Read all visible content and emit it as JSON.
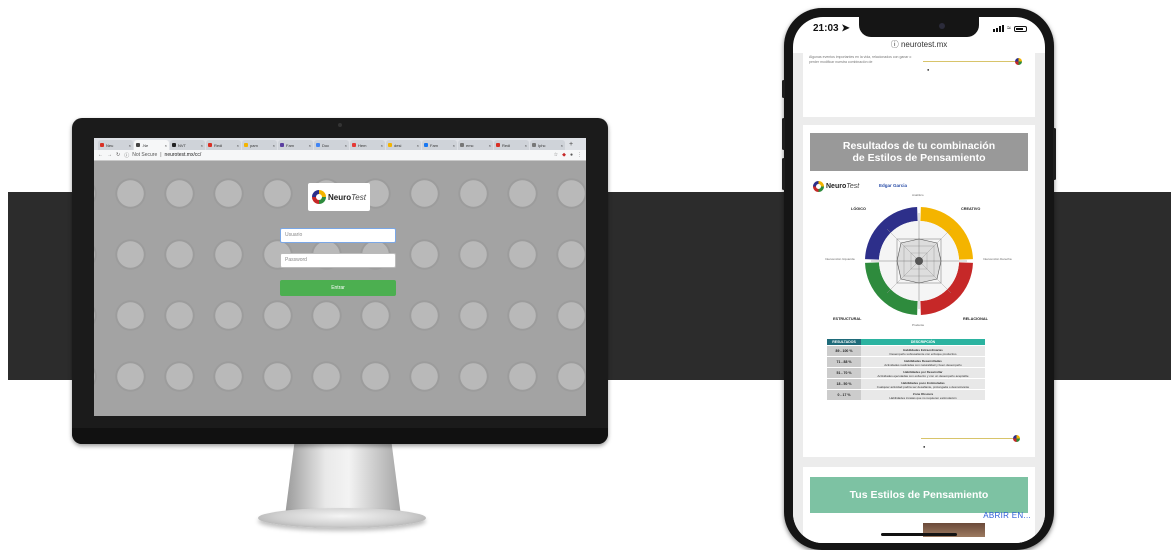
{
  "desktop": {
    "tabs": [
      {
        "label": "Neu",
        "color": "#d93025"
      },
      {
        "label": ".Ne",
        "color": "#444444",
        "active": true
      },
      {
        "label": "NVT",
        "color": "#222222"
      },
      {
        "label": "Redi",
        "color": "#d93025"
      },
      {
        "label": "pam",
        "color": "#f4b400"
      },
      {
        "label": "Fam",
        "color": "#5b3fa0"
      },
      {
        "label": "Doc",
        "color": "#4285f4"
      },
      {
        "label": "Hem",
        "color": "#e53935"
      },
      {
        "label": "desi",
        "color": "#f4b400"
      },
      {
        "label": "Fam",
        "color": "#1877f2"
      },
      {
        "label": "emc",
        "color": "#777777"
      },
      {
        "label": "Redi",
        "color": "#d93025"
      },
      {
        "label": "Iphc",
        "color": "#777777"
      }
    ],
    "new_tab": "+",
    "address": {
      "security": "Not Secure",
      "separator": "|",
      "url": "neurotest.mx/cc/"
    },
    "logo": {
      "brand": "Neuro",
      "brand_suffix": "Test"
    },
    "username_placeholder": "Usuario",
    "password_placeholder": "Password",
    "submit_label": "Entrar"
  },
  "phone": {
    "time": "21:03",
    "url": "neurotest.mx",
    "card1_text": "Algunas eventos importantes en la vida, relacionados con ganar o perder modificar nuestra combinación de",
    "results_title_line1": "Resultados de tu combinación",
    "results_title_line2": "de Estilos de Pensamiento",
    "logo": {
      "brand": "Neuro",
      "brand_suffix": "Test"
    },
    "user_name": "Edgar Garcia",
    "quadrants": {
      "top_left": "LÓGICO",
      "top_right": "CREATIVO",
      "bottom_left": "ESTRUCTURAL",
      "bottom_right": "RELACIONAL"
    },
    "sides": {
      "top": "Analítico",
      "left": "Intervención Izquierda",
      "right": "Intervención Derecha",
      "bottom": "Prudente"
    },
    "quadrant_colors": [
      "#2d2f8a",
      "#f4b400",
      "#c62828",
      "#2e8b3d"
    ],
    "table": {
      "headers": [
        "RESULTADOS",
        "DESCRIPCIÓN"
      ],
      "rows": [
        {
          "range": "89 - 100 %",
          "title": "Habilidades Extraordinarias",
          "desc": "Desempeño sobresaliente con enfoque productivo"
        },
        {
          "range": "71 - 88 %",
          "title": "Habilidades Desarrolladas",
          "desc": "Actividades realizadas con naturalidad y buen desempeño"
        },
        {
          "range": "51 - 70 %",
          "title": "Habilidades por Desarrollar",
          "desc": "Actividades ejecutadas con esfuerzo y con un desempeño aceptable"
        },
        {
          "range": "18 - 50 %",
          "title": "Habilidades poco Estimuladas",
          "desc": "Cualquier actividad podría ser desafiante, prolongada o desmotivante"
        },
        {
          "range": "0 - 17 %",
          "title": "Zona Obscura",
          "desc": "Habilidades innatas que no requieren estimulación"
        }
      ]
    },
    "styles_banner": "Tus Estilos de Pensamiento",
    "open_in": "ABRIR EN..."
  }
}
